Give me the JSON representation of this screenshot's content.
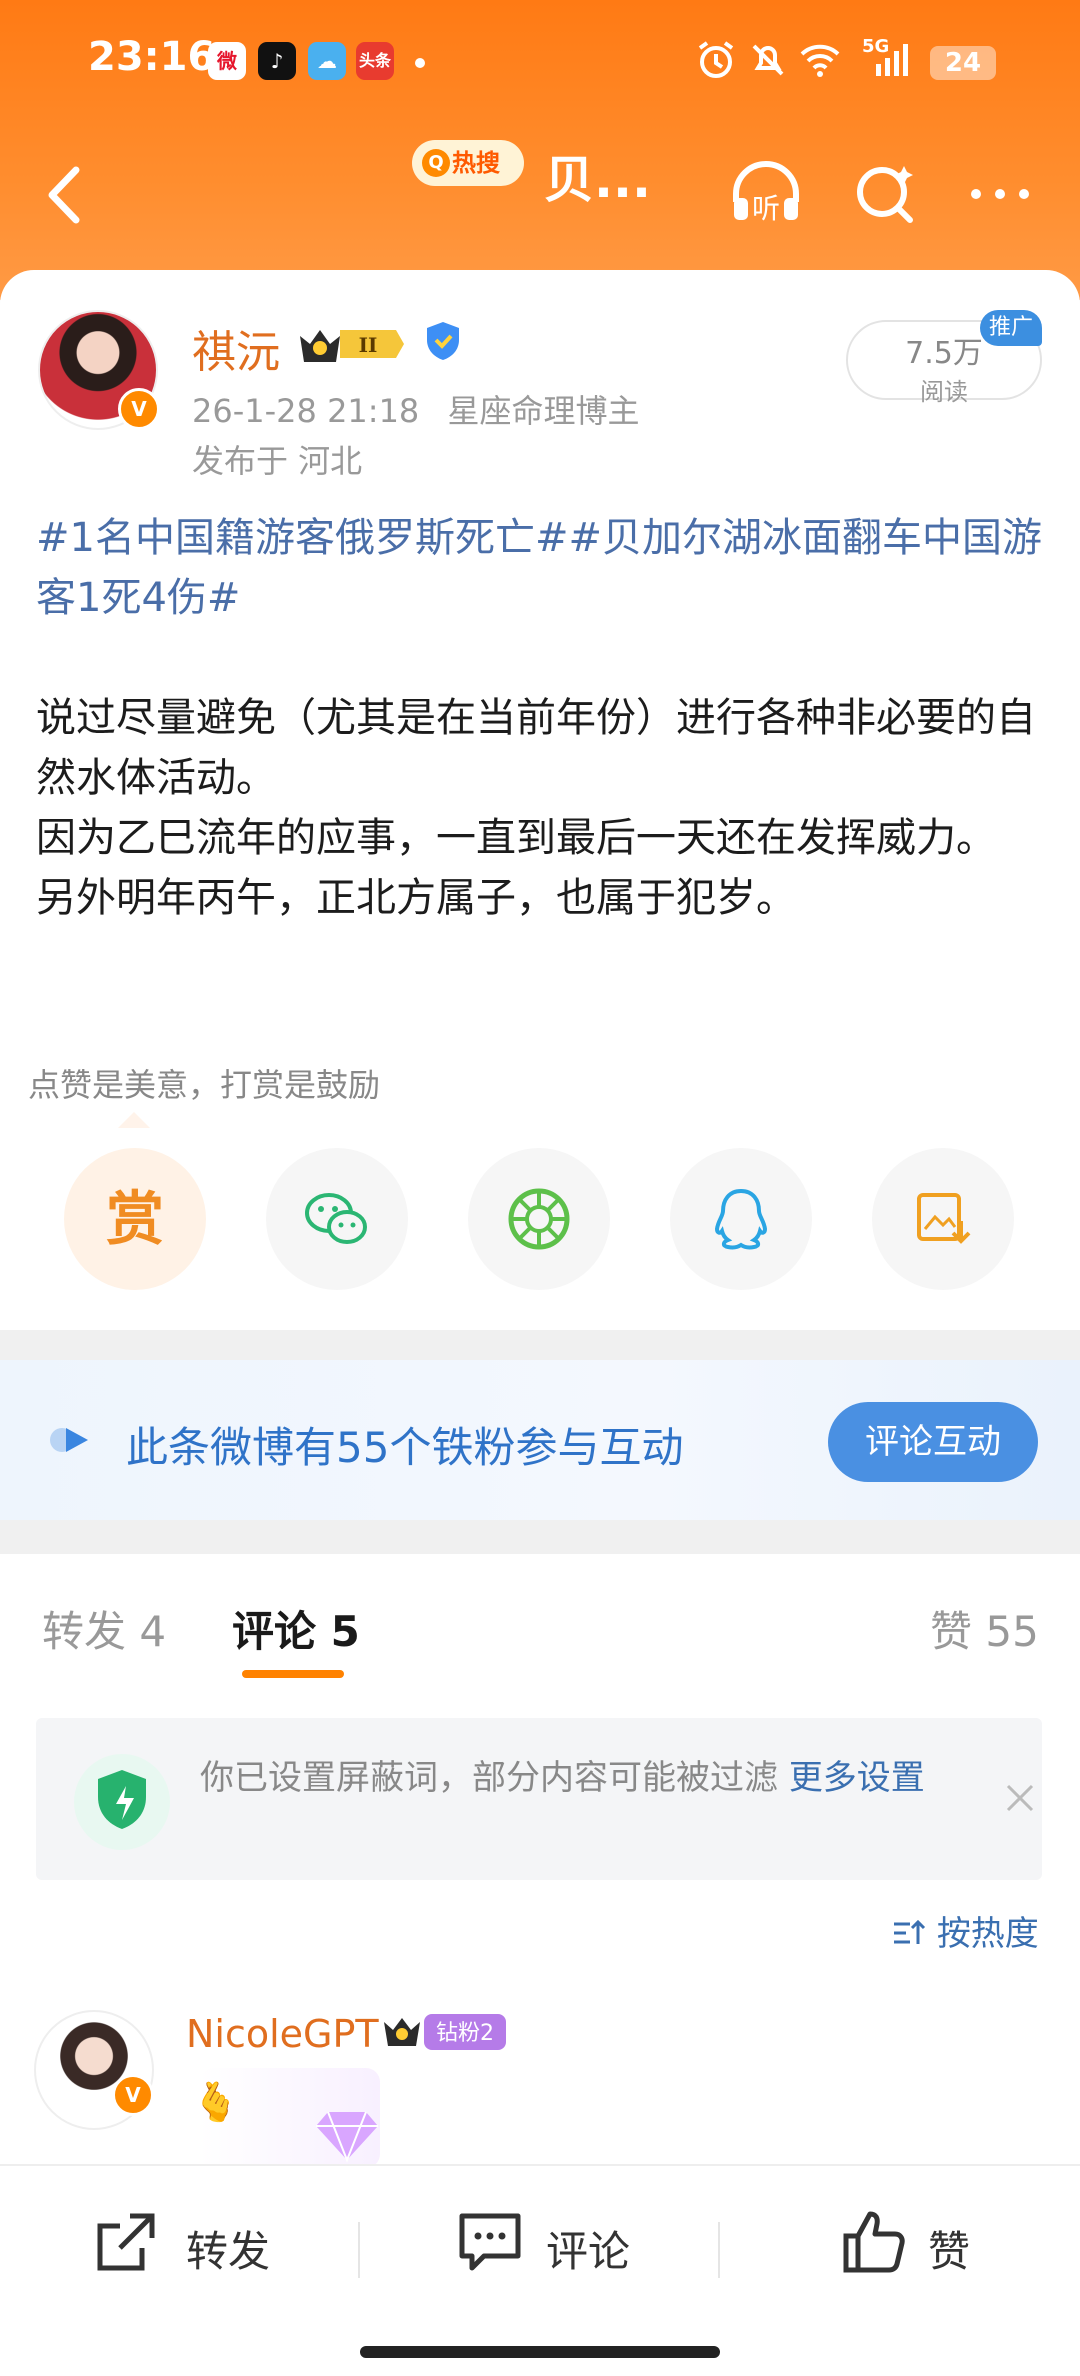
{
  "status_bar": {
    "time": "23:16",
    "apps": [
      "weibo-icon",
      "tiktok-icon",
      "weather-icon",
      "toutiao-icon"
    ],
    "app_toutiao_text": "头条",
    "network": "5G",
    "battery": "24"
  },
  "nav": {
    "hot_search": "热搜",
    "title": "贝...",
    "listen_label": "听"
  },
  "post": {
    "author": "祺沅",
    "level_badge": "II",
    "time": "26-1-28 21:18",
    "role": "星座命理博主",
    "location": "发布于 河北",
    "reads": "7.5万",
    "reads_label": "阅读",
    "promo": "推广",
    "tags": "#1名中国籍游客俄罗斯死亡##贝加尔湖冰面翻车中国游客1死4伤#",
    "body": [
      "说过尽量避免（尤其是在当前年份）进行各种非必要的自然水体活动。",
      "因为乙巳流年的应事，一直到最后一天还在发挥威力。",
      "另外明年丙午，正北方属子，也属于犯岁。"
    ],
    "tip": "点赞是美意，打赏是鼓励",
    "reward_label": "赏"
  },
  "share_targets": [
    "reward",
    "wechat",
    "moments",
    "qq",
    "save-image"
  ],
  "fans_bar": {
    "text": "此条微博有55个铁粉参与互动",
    "button": "评论互动"
  },
  "tabs": {
    "repost": "转发 4",
    "comment": "评论 5",
    "like": "赞 55"
  },
  "filter_notice": {
    "text": "你已设置屏蔽词，部分内容可能被过滤 ",
    "more": "更多设置"
  },
  "sort": "按热度",
  "comment": {
    "user": "NicoleGPT",
    "badge": "钻粉2",
    "text": "🫰"
  },
  "bottom_bar": {
    "repost": "转发",
    "comment": "评论",
    "like": "赞"
  },
  "colors": {
    "header_orange": "#ff7a14",
    "tag_blue": "#4a6ea8",
    "accent_orange": "#ff8200",
    "fans_blue": "#4a90e2"
  }
}
